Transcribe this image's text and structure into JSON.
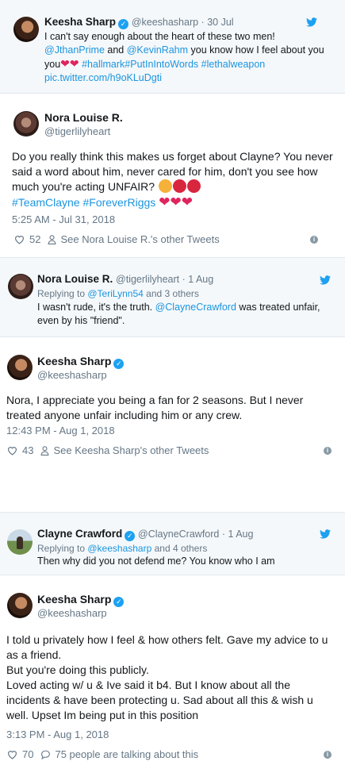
{
  "tweets": [
    {
      "name": "Keesha Sharp",
      "handle": "@keeshasharp",
      "sep": " · ",
      "date": "30 Jul",
      "text_a": "I can't say enough about the heart of these two men!",
      "mention1": "@JthanPrime",
      "and": " and ",
      "mention2": "@KevinRahm",
      "text_b": " you know how I feel about you",
      "hashtags": " #hallmark#PutInIntoWords #lethalweapon",
      "link": "pic.twitter.com/h9oKLuDgti"
    },
    {
      "name": "Nora Louise R.",
      "handle": "@tigerlilyheart",
      "text": "Do you really think this makes us forget about Clayne? You never said a word about him, never cared for him, don't you see how much you're acting UNFAIR?",
      "hashtags": "#TeamClayne #ForeverRiggs",
      "timestamp": "5:25 AM - Jul 31, 2018",
      "likes": "52",
      "other": "See Nora Louise R.'s other Tweets"
    },
    {
      "name": "Nora Louise R.",
      "handle": "@tigerlilyheart",
      "sep": " · ",
      "date": "1 Aug",
      "reply_prefix": "Replying to ",
      "reply_to": "@TeriLynn54",
      "reply_suffix": " and 3 others",
      "text_a": "I wasn't rude, it's the truth. ",
      "mention": "@ClayneCrawford",
      "text_b": " was treated unfair, even by his \"friend\"."
    },
    {
      "name": "Keesha Sharp",
      "handle": "@keeshasharp",
      "text": "Nora, I appreciate you being a fan for 2 seasons. But I never treated anyone unfair including him or any crew.",
      "timestamp": "12:43 PM - Aug 1, 2018",
      "likes": "43",
      "other": "See Keesha Sharp's other Tweets"
    },
    {
      "name": "Clayne Crawford",
      "handle": "@ClayneCrawford",
      "sep": " · ",
      "date": "1 Aug",
      "reply_prefix": "Replying to ",
      "reply_to": "@keeshasharp",
      "reply_suffix": " and 4 others",
      "text": "Then why did you not defend me? You know who I am"
    },
    {
      "name": "Keesha Sharp",
      "handle": "@keeshasharp",
      "p1": "I told u privately how I feel & how others felt. Gave my advice to u as a friend.",
      "p2": "But you're doing this publicly.",
      "p3": "Loved acting w/ u & Ive said it b4. But I know about all the incidents & have been protecting u. Sad about all this & wish u well. Upset Im being put in this position",
      "timestamp": "3:13 PM - Aug 1, 2018",
      "likes": "70",
      "talking": "75 people are talking about this"
    }
  ],
  "colors": {
    "link": "#1b95e0",
    "twitter_blue": "#1da1f2",
    "heart": "#e0245e",
    "muted": "#657786"
  },
  "icons": [
    "twitter-bird-icon",
    "verified-badge-icon",
    "heart-icon",
    "person-icon",
    "comment-icon",
    "info-icon"
  ]
}
